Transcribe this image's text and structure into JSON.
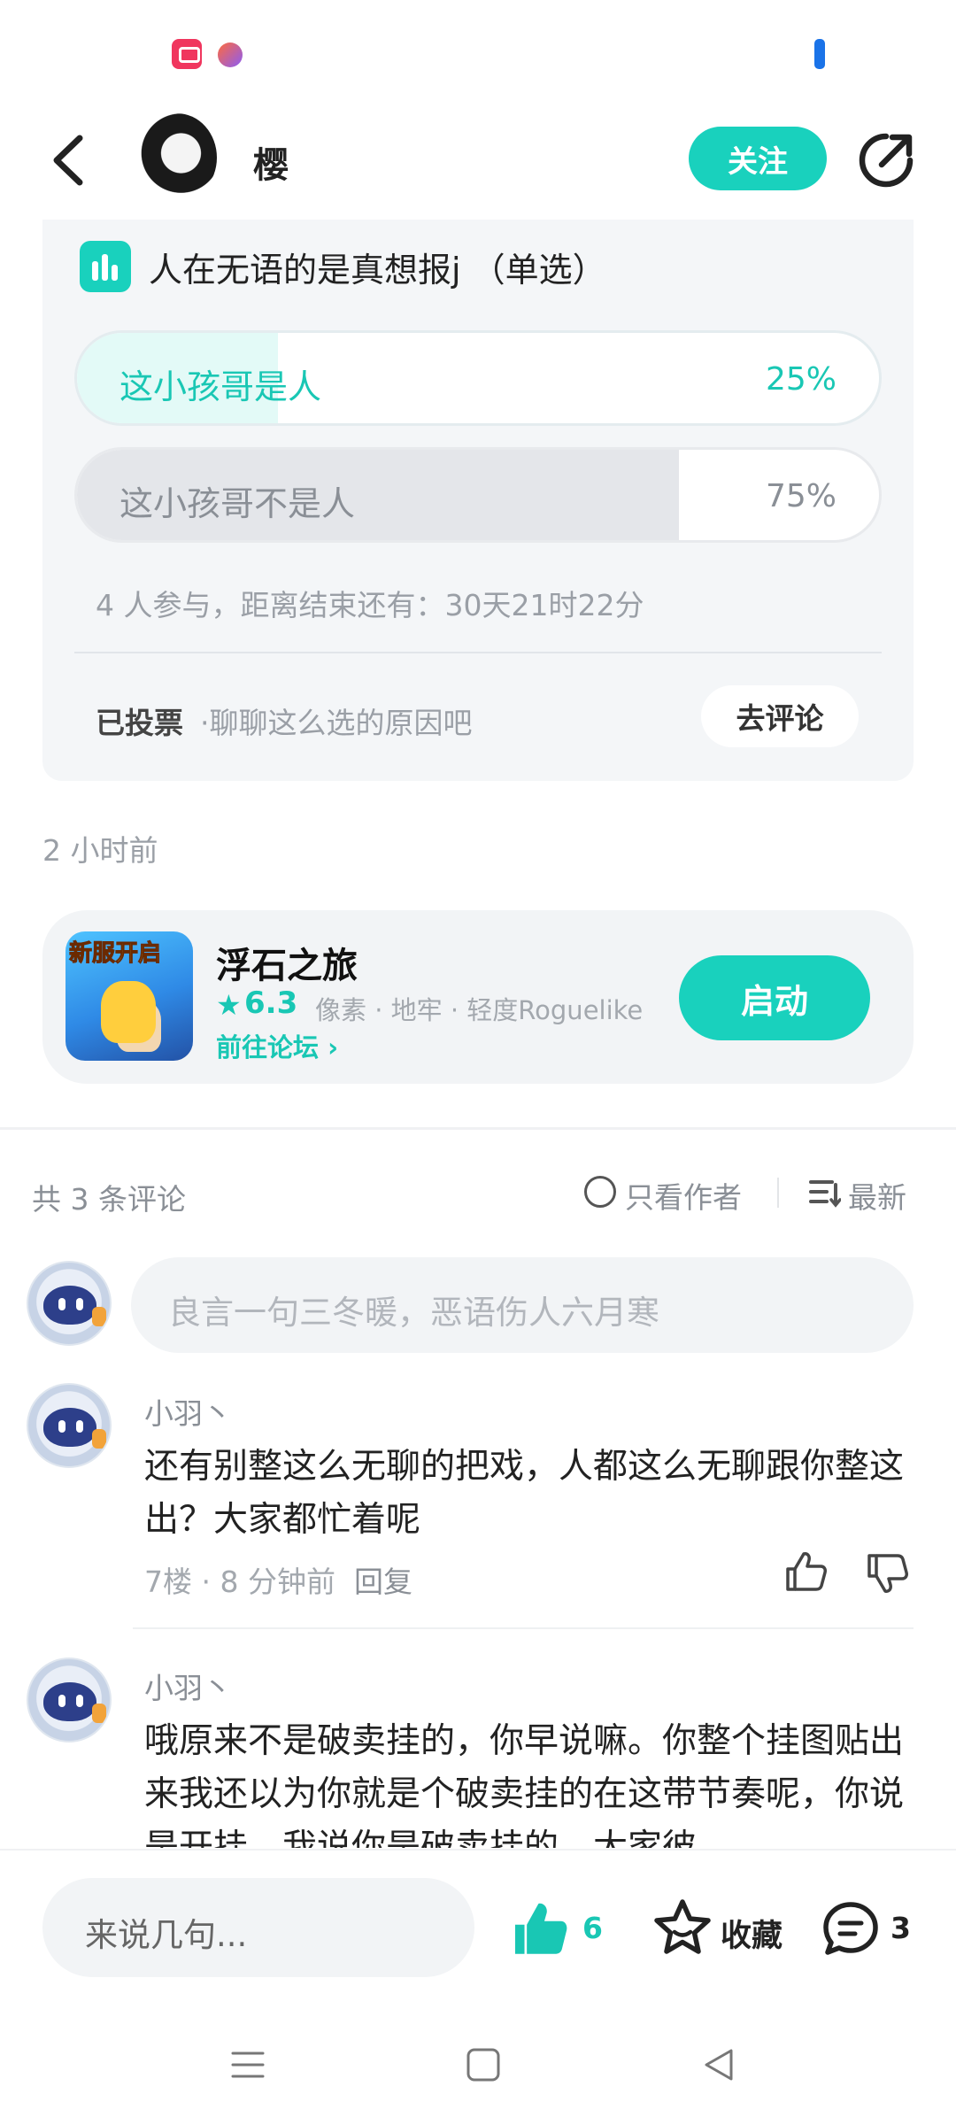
{
  "header": {
    "user_name": "樱",
    "follow_label": "关注"
  },
  "poll": {
    "title": "人在无语的是真想报j （单选）",
    "options": [
      {
        "label": "这小孩哥是人",
        "percent_label": "25%",
        "percent": 25
      },
      {
        "label": "这小孩哥不是人",
        "percent_label": "75%",
        "percent": 75
      }
    ],
    "meta": "4 人参与，距离结束还有：30天21时22分",
    "voted_label": "已投票",
    "voted_hint": "·聊聊这么选的原因吧",
    "comment_cta": "去评论"
  },
  "post": {
    "time": "2 小时前"
  },
  "game": {
    "icon_banner": "新服开启",
    "name": "浮石之旅",
    "star": "★",
    "rating": "6.3",
    "tags": "像素 · 地牢 · 轻度Roguelike",
    "forum_link": "前往论坛 ›",
    "launch_label": "启动"
  },
  "comments_header": {
    "count": "共 3 条评论",
    "author_only": "只看作者",
    "sort": "最新"
  },
  "comment_input": {
    "placeholder": "良言一句三冬暖，恶语伤人六月寒"
  },
  "comments": [
    {
      "name": "小羽丶",
      "text": "还有别整这么无聊的把戏，人都这么无聊跟你整这出？大家都忙着呢",
      "meta": "7楼 · 8 分钟前",
      "reply": "回复"
    },
    {
      "name": "小羽丶",
      "text": "哦原来不是破卖挂的，你早说嘛。你整个挂图贴出来我还以为你就是个破卖挂的在这带节奏呢，你说是开挂，我说你是破卖挂的，大家彼"
    }
  ],
  "bottom_bar": {
    "input_placeholder": "来说几句...",
    "like_count": "6",
    "favorite_label": "收藏",
    "comment_count": "3"
  },
  "colors": {
    "accent": "#19d1bd",
    "accent_text": "#19c7b4"
  }
}
